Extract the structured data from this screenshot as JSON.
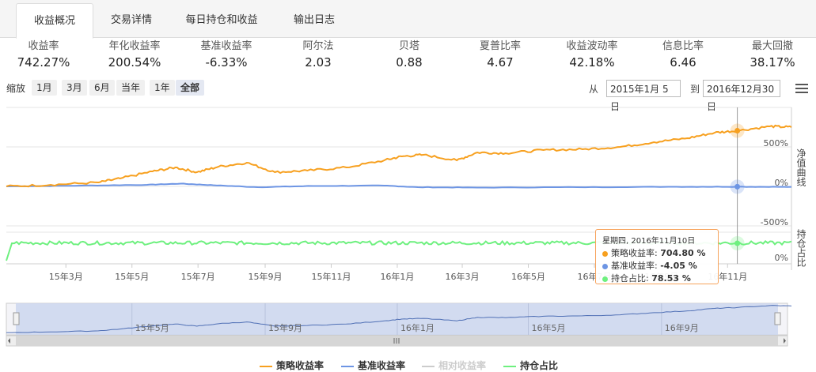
{
  "tabs": [
    "收益概况",
    "交易详情",
    "每日持仓和收益",
    "输出日志"
  ],
  "stats": [
    {
      "label": "收益率",
      "value": "742.27%"
    },
    {
      "label": "年化收益率",
      "value": "200.54%"
    },
    {
      "label": "基准收益率",
      "value": "-6.33%"
    },
    {
      "label": "阿尔法",
      "value": "2.03"
    },
    {
      "label": "贝塔",
      "value": "0.88"
    },
    {
      "label": "夏普比率",
      "value": "4.67"
    },
    {
      "label": "收益波动率",
      "value": "42.18%"
    },
    {
      "label": "信息比率",
      "value": "6.46"
    },
    {
      "label": "最大回撤",
      "value": "38.17%"
    }
  ],
  "zoom": {
    "label": "缩放",
    "buttons": [
      "1月",
      "3月",
      "6月",
      "当年",
      "1年",
      "全部"
    ],
    "active": "全部"
  },
  "range": {
    "from_label": "从",
    "from": "2015年1月 5日",
    "to_label": "到",
    "to": "2016年12月30日"
  },
  "chart_data": {
    "type": "line",
    "x_range": [
      "2015-01-05",
      "2016-12-30"
    ],
    "x_tick_labels": [
      "15年3月",
      "15年5月",
      "15年7月",
      "15年9月",
      "15年11月",
      "16年1月",
      "16年3月",
      "16年5月",
      "16年7月",
      "16年9月",
      "16年11月"
    ],
    "navigator_tick_labels": [
      "15年5月",
      "15年9月",
      "16年1月",
      "16年5月",
      "16年9月"
    ],
    "panes": [
      {
        "ylabel": "净值曲线",
        "y_tick_labels": [
          "500%",
          "0%",
          "-500%"
        ],
        "ylim": [
          -500,
          800
        ]
      },
      {
        "ylabel": "持仓占比",
        "y_tick_labels": [
          "0%"
        ],
        "ylim": [
          0,
          100
        ]
      }
    ],
    "series": [
      {
        "name": "策略收益率",
        "color": "#f7a01f",
        "points": [
          [
            "2015-01-05",
            0
          ],
          [
            "2015-02-15",
            20
          ],
          [
            "2015-03-31",
            50
          ],
          [
            "2015-04-20",
            100
          ],
          [
            "2015-05-20",
            190
          ],
          [
            "2015-06-10",
            240
          ],
          [
            "2015-06-30",
            180
          ],
          [
            "2015-07-20",
            250
          ],
          [
            "2015-08-15",
            300
          ],
          [
            "2015-09-10",
            180
          ],
          [
            "2015-10-10",
            200
          ],
          [
            "2015-11-15",
            240
          ],
          [
            "2015-12-20",
            330
          ],
          [
            "2016-01-05",
            380
          ],
          [
            "2016-01-25",
            400
          ],
          [
            "2016-02-25",
            330
          ],
          [
            "2016-03-15",
            430
          ],
          [
            "2016-04-10",
            420
          ],
          [
            "2016-05-15",
            460
          ],
          [
            "2016-06-20",
            470
          ],
          [
            "2016-07-25",
            500
          ],
          [
            "2016-08-25",
            560
          ],
          [
            "2016-09-25",
            610
          ],
          [
            "2016-10-20",
            680
          ],
          [
            "2016-11-10",
            704.8
          ],
          [
            "2016-12-10",
            760
          ],
          [
            "2016-12-30",
            750
          ]
        ]
      },
      {
        "name": "基准收益率",
        "color": "#6d95e4",
        "points": [
          [
            "2015-01-05",
            0
          ],
          [
            "2015-03-15",
            10
          ],
          [
            "2015-05-15",
            20
          ],
          [
            "2015-06-15",
            35
          ],
          [
            "2015-07-15",
            15
          ],
          [
            "2015-08-25",
            -10
          ],
          [
            "2015-10-15",
            5
          ],
          [
            "2015-12-20",
            10
          ],
          [
            "2016-01-20",
            -10
          ],
          [
            "2016-03-15",
            -15
          ],
          [
            "2016-06-15",
            -10
          ],
          [
            "2016-09-15",
            -5
          ],
          [
            "2016-11-10",
            -4.05
          ],
          [
            "2016-12-30",
            -6.33
          ]
        ]
      },
      {
        "name": "相对收益率",
        "color": "#cccccc",
        "visible": false
      },
      {
        "name": "持仓占比",
        "color": "#6ef07f",
        "pane": 1,
        "typical": 80,
        "min": 0
      }
    ],
    "tooltip": {
      "date": "星期四, 2016年11月10日",
      "values": [
        "704.80 %",
        "-4.05 %",
        "78.53 %"
      ]
    },
    "legend": [
      "策略收益率",
      "基准收益率",
      "相对收益率",
      "持仓占比"
    ]
  }
}
